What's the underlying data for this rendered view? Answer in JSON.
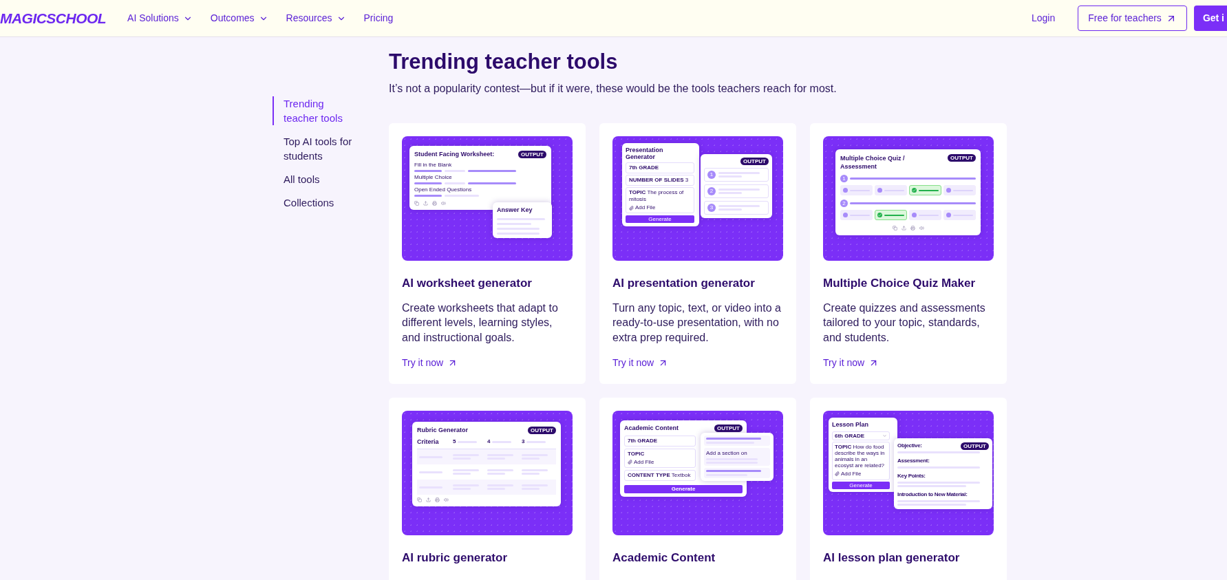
{
  "header": {
    "logo": "MAGICSCHOOL",
    "nav": [
      {
        "label": "AI Solutions",
        "dropdown": true
      },
      {
        "label": "Outcomes",
        "dropdown": true
      },
      {
        "label": "Resources",
        "dropdown": true
      },
      {
        "label": "Pricing",
        "dropdown": false
      }
    ],
    "login": "Login",
    "cta_outline": "Free for teachers",
    "cta_filled": "Get i"
  },
  "sidebar": {
    "items": [
      {
        "label": "Trending teacher tools",
        "selected": true
      },
      {
        "label": "Top AI tools for students",
        "selected": false
      },
      {
        "label": "All tools",
        "selected": false
      },
      {
        "label": "Collections",
        "selected": false
      }
    ]
  },
  "section": {
    "title": "Trending teacher tools",
    "subtitle": "It’s not a popularity contest—but if it were, these would be the tools teachers reach for most."
  },
  "cards": [
    {
      "title": "AI worksheet generator",
      "description": "Create worksheets that adapt to different levels, learning styles, and instructional goals.",
      "link": "Try it now",
      "illustration": {
        "kind": "worksheet",
        "title": "Student Facing Worksheet:",
        "badge": "OUTPUT",
        "sections": [
          "Fill in the Blank",
          "Multiple Choice",
          "Open Ended Questions"
        ],
        "answer_title": "Answer Key"
      }
    },
    {
      "title": "AI presentation generator",
      "description": "Turn any topic, text, or video into a ready-to-use presentation, with no extra prep required.",
      "link": "Try it now",
      "illustration": {
        "kind": "presentation",
        "title": "Presentation Generator",
        "badge": "OUTPUT",
        "fields": [
          {
            "label": "7th GRADE"
          },
          {
            "label": "NUMBER OF SLIDES",
            "value": "3"
          },
          {
            "label": "TOPIC",
            "value": "The process of mitosis",
            "add_file": "Add File"
          }
        ],
        "button": "Generate",
        "slides": [
          "1",
          "2",
          "3"
        ]
      }
    },
    {
      "title": "Multiple Choice Quiz Maker",
      "description": "Create quizzes and assessments tailored to your topic, standards, and students.",
      "link": "Try it now",
      "illustration": {
        "kind": "quiz",
        "title": "Multiple Choice Quiz / Assessment",
        "badge": "OUTPUT",
        "questions": [
          {
            "number": "1",
            "options": [
              {
                "selected": false
              },
              {
                "selected": false
              },
              {
                "selected": true
              },
              {
                "selected": false
              }
            ]
          },
          {
            "number": "2",
            "options": [
              {
                "selected": false
              },
              {
                "selected": true
              },
              {
                "selected": false
              },
              {
                "selected": false
              }
            ]
          }
        ]
      }
    },
    {
      "title": "AI rubric generator",
      "illustration": {
        "kind": "rubric",
        "title": "Rubric Generator",
        "badge": "OUTPUT",
        "criteria": "Criteria",
        "scores": [
          "5",
          "4",
          "3"
        ]
      }
    },
    {
      "title": "Academic Content",
      "illustration": {
        "kind": "academic",
        "title": "Academic Content",
        "badge": "OUTPUT",
        "fields": [
          {
            "label": "7th GRADE"
          },
          {
            "label": "TOPIC",
            "add_file": "Add File"
          },
          {
            "label": "CONTENT TYPE",
            "value": "Textbok"
          }
        ],
        "button": "Generate",
        "popup_text": "Add a section on"
      }
    },
    {
      "title": "AI lesson plan generator",
      "illustration": {
        "kind": "lesson",
        "title": "Lesson Plan",
        "grade": "6th GRADE",
        "topic_label": "TOPIC",
        "topic": "How do food describe the ways in animals in an ecosyst are related?",
        "add_file": "Add File",
        "button": "Generate",
        "badge": "OUTPUT",
        "headings": [
          "Objective:",
          "Assessment:",
          "Key Points:",
          "Introduction to New Material:"
        ]
      }
    }
  ]
}
